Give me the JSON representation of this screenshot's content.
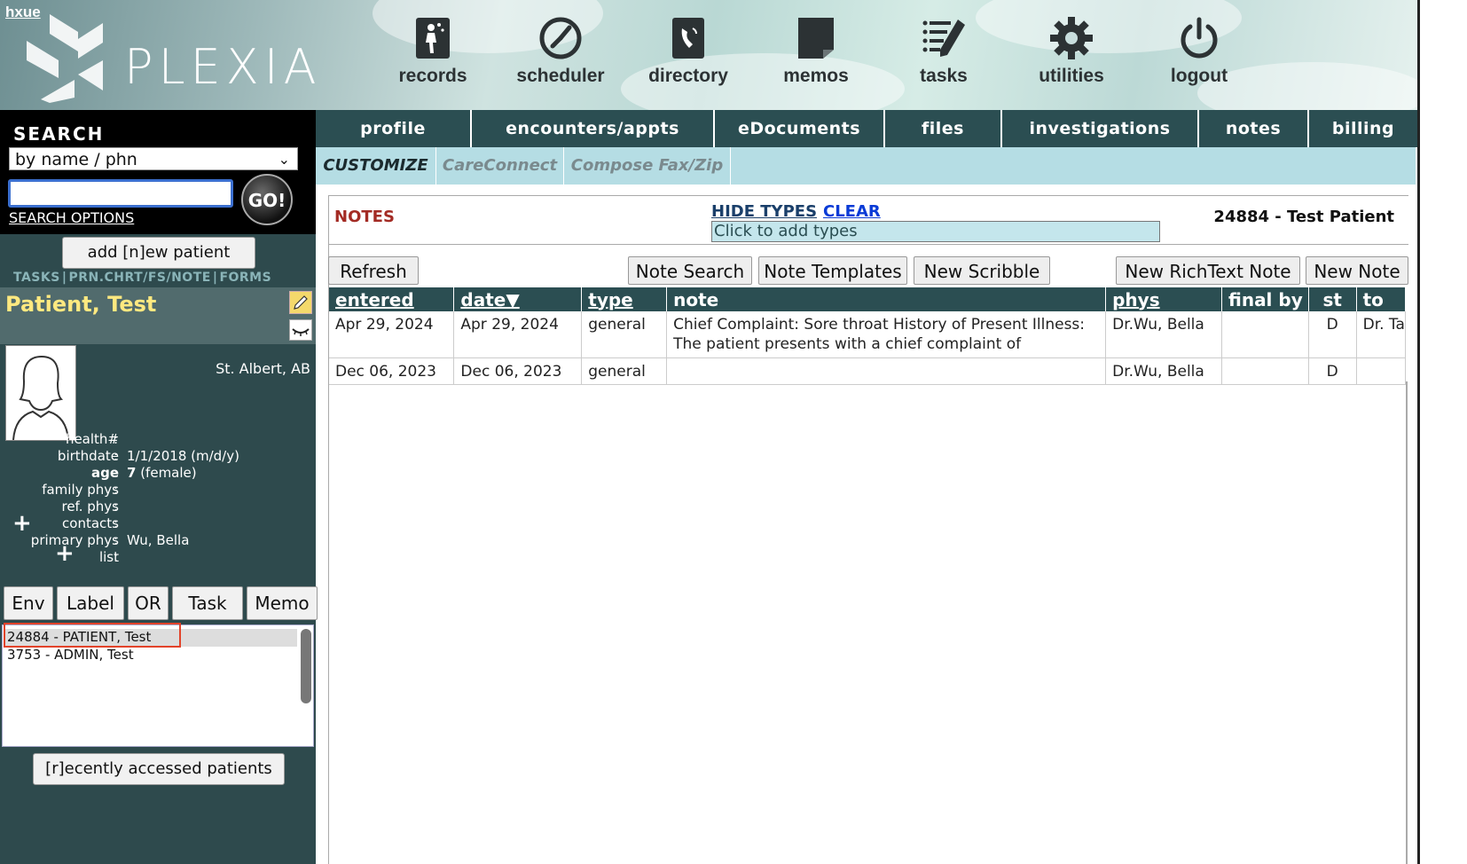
{
  "header": {
    "user": "hxue",
    "logo_text": "PLEXIA",
    "nav": [
      {
        "label": "records",
        "icon": "records-icon"
      },
      {
        "label": "scheduler",
        "icon": "scheduler-icon"
      },
      {
        "label": "directory",
        "icon": "directory-icon"
      },
      {
        "label": "memos",
        "icon": "memos-icon"
      },
      {
        "label": "tasks",
        "icon": "tasks-icon"
      },
      {
        "label": "utilities",
        "icon": "gear-icon"
      },
      {
        "label": "logout",
        "icon": "power-icon"
      }
    ]
  },
  "sidebar": {
    "search_title": "SEARCH",
    "search_mode": "by name / phn",
    "search_value": "",
    "go_label": "GO!",
    "search_options": "SEARCH OPTIONS",
    "add_patient": "add [n]ew patient",
    "quick_links": [
      "TASKS",
      "PRN.CHRT/FS/NOTE",
      "FORMS"
    ],
    "patient_name": "Patient, Test",
    "location": "St. Albert, AB",
    "info": [
      {
        "key": "health#",
        "value": ""
      },
      {
        "key": "birthdate",
        "value": "1/1/2018 (m/d/y)"
      },
      {
        "key": "age",
        "value_bold": "7",
        "value": " (female)"
      },
      {
        "key": "family phys",
        "value": ""
      },
      {
        "key": "ref. phys",
        "value": ""
      },
      {
        "key": "contacts",
        "value": ""
      },
      {
        "key": "primary phys",
        "value": "Wu, Bella"
      },
      {
        "key": "list",
        "value": ""
      }
    ],
    "actions": [
      "Env",
      "Label",
      "OR",
      "Task",
      "Memo"
    ],
    "patient_list": [
      "24884 - PATIENT, Test",
      "3753 - ADMIN, Test"
    ],
    "recent_button": "[r]ecently accessed patients"
  },
  "main_tabs": [
    "profile",
    "encounters/appts",
    "eDocuments",
    "files",
    "investigations",
    "notes",
    "billing"
  ],
  "sub_tabs": [
    "CUSTOMIZE",
    "CareConnect",
    "Compose Fax/Zip"
  ],
  "notes": {
    "title": "NOTES",
    "hide_types": "HIDE TYPES",
    "clear": "CLEAR",
    "types_placeholder": "Click to add types",
    "patient_label": "24884 - Test Patient",
    "buttons": {
      "refresh": "Refresh",
      "note_search": "Note Search",
      "note_templates": "Note Templates",
      "new_scribble": "New Scribble",
      "new_richtext": "New RichText Note",
      "new_note": "New Note"
    },
    "columns": [
      "entered",
      "date▼",
      "type",
      "note",
      "phys",
      "final by",
      "st",
      "to"
    ],
    "rows": [
      {
        "entered": "Apr 29, 2024",
        "date": "Apr 29, 2024",
        "type": "general",
        "note": "Chief Complaint: Sore throat History of Present Illness: The patient presents with a chief complaint of",
        "phys": "Dr.Wu, Bella",
        "final_by": "",
        "st": "D",
        "to": "Dr. Ta"
      },
      {
        "entered": "Dec 06, 2023",
        "date": "Dec 06, 2023",
        "type": "general",
        "note": "",
        "phys": "Dr.Wu, Bella",
        "final_by": "",
        "st": "D",
        "to": ""
      }
    ]
  }
}
